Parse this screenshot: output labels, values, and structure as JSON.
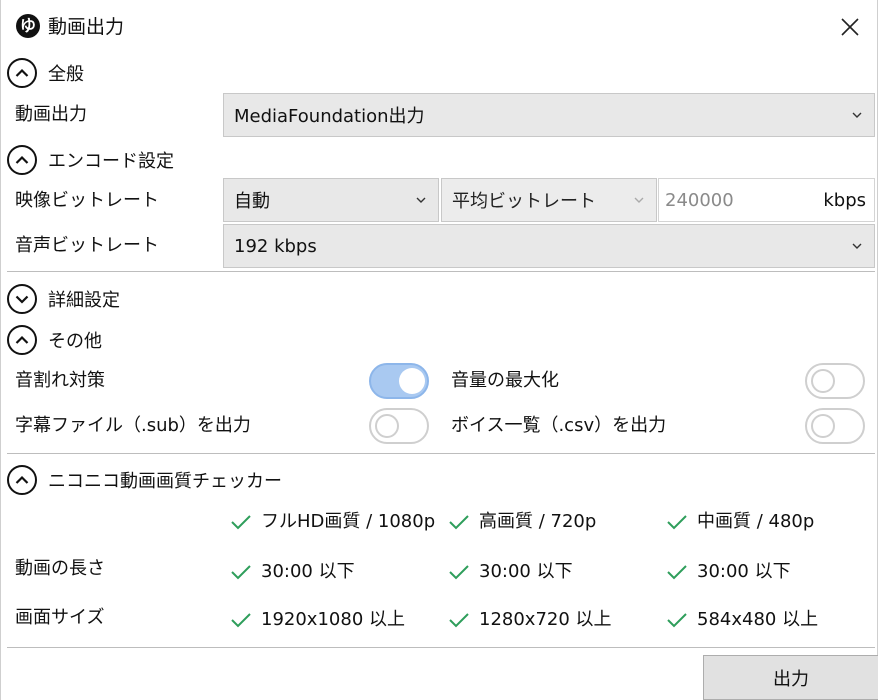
{
  "window": {
    "title": "動画出力",
    "app_icon_glyph": "ゆ"
  },
  "sections": {
    "general": "全般",
    "encode": "エンコード設定",
    "details": "詳細設定",
    "other": "その他",
    "checker": "ニコニコ動画画質チェッカー"
  },
  "general": {
    "video_output_label": "動画出力",
    "video_output_value": "MediaFoundation出力"
  },
  "encode": {
    "video_bitrate_label": "映像ビットレート",
    "bitrate_mode": "自動",
    "bitrate_type": "平均ビットレート",
    "bitrate_value": "240000",
    "bitrate_unit": "kbps",
    "audio_bitrate_label": "音声ビットレート",
    "audio_bitrate_value": "192 kbps"
  },
  "other": {
    "clip_prevention_label": "音割れ対策",
    "clip_prevention_on": true,
    "maximize_volume_label": "音量の最大化",
    "maximize_volume_on": false,
    "subtitle_label": "字幕ファイル（.sub）を出力",
    "subtitle_on": false,
    "voice_list_label": "ボイス一覧（.csv）を出力",
    "voice_list_on": false
  },
  "checker": {
    "headers": [
      "フルHD画質 / 1080p",
      "高画質 / 720p",
      "中画質 / 480p"
    ],
    "length_label": "動画の長さ",
    "length_values": [
      "30:00 以下",
      "30:00 以下",
      "30:00 以下"
    ],
    "size_label": "画面サイズ",
    "size_values": [
      "1920x1080 以上",
      "1280x720 以上",
      "584x480 以上"
    ],
    "check_color": "#2e9e5b"
  },
  "actions": {
    "output_button": "出力"
  },
  "colors": {
    "toggle_on": "#a9c9f1",
    "combo_bg": "#e8e8e8"
  },
  "icons": {
    "close": "close-icon",
    "chevron_up": "chevron-up-icon",
    "chevron_down": "chevron-down-icon",
    "check": "check-icon"
  }
}
